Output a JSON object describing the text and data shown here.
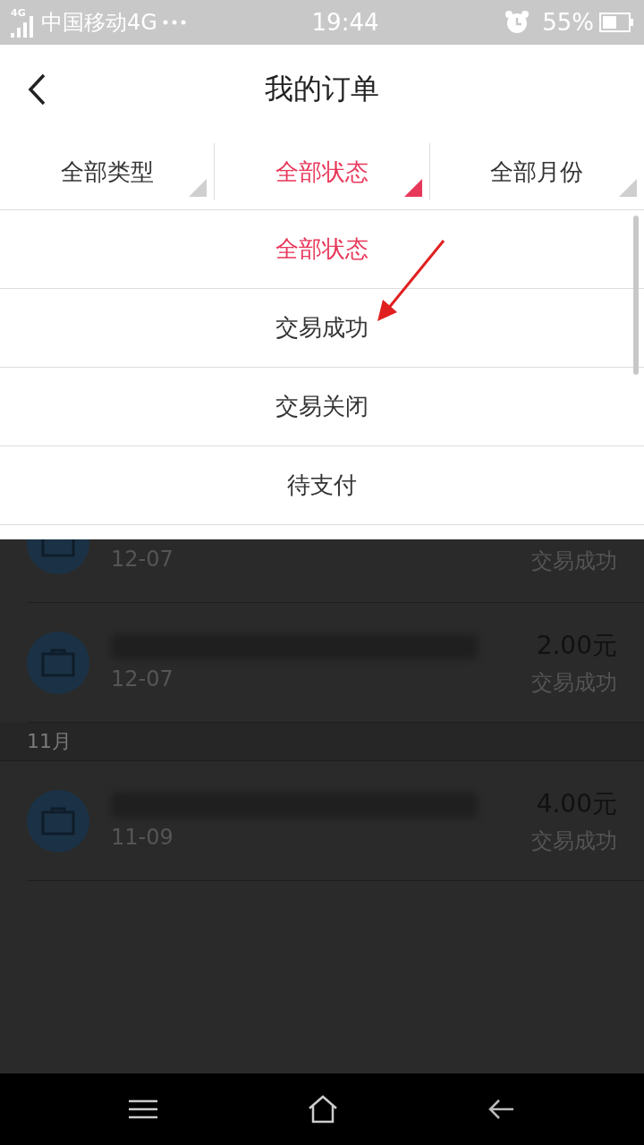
{
  "status_bar": {
    "carrier": "中国移动4G",
    "network": "4G",
    "time": "19:44",
    "battery": "55%"
  },
  "header": {
    "title": "我的订单"
  },
  "filters": [
    {
      "label": "全部类型",
      "selected": false
    },
    {
      "label": "全部状态",
      "selected": true
    },
    {
      "label": "全部月份",
      "selected": false
    }
  ],
  "dropdown": [
    {
      "label": "全部状态",
      "selected": true
    },
    {
      "label": "交易成功",
      "selected": false
    },
    {
      "label": "交易关闭",
      "selected": false
    },
    {
      "label": "待支付",
      "selected": false
    }
  ],
  "orders": [
    {
      "kind": "order",
      "date": "12-07",
      "status": "交易成功",
      "partial": true
    },
    {
      "kind": "order",
      "amount": "2.00元",
      "date": "12-07",
      "status": "交易成功"
    },
    {
      "kind": "month",
      "label": "11月"
    },
    {
      "kind": "order",
      "amount": "4.00元",
      "date": "11-09",
      "status": "交易成功"
    }
  ]
}
